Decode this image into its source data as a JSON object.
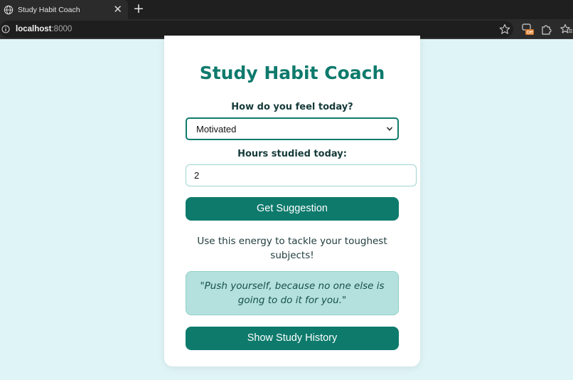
{
  "browser": {
    "tab_title": "Study Habit Coach",
    "tab_close": "✕",
    "new_tab": "+",
    "url_host": "localhost",
    "url_port": ":8000",
    "extension_badge": "Off"
  },
  "app": {
    "title": "Study Habit Coach",
    "mood_label": "How do you feel today?",
    "mood_value": "Motivated",
    "hours_label": "Hours studied today:",
    "hours_value": "2",
    "suggest_button": "Get Suggestion",
    "suggestion_text": "Use this energy to tackle your toughest subjects!",
    "quote_text": "\"Push yourself, because no one else is going to do it for you.\"",
    "history_button": "Show Study History"
  },
  "colors": {
    "page_bg": "#dff4f6",
    "accent": "#0d7a6c",
    "quote_bg": "#b4e1de"
  },
  "icons": {
    "tab_favicon": "globe-icon",
    "site_info": "info-icon",
    "bookmark": "star-icon",
    "extensions": [
      "extension-off-icon",
      "puzzle-icon",
      "favorites-icon"
    ],
    "select_arrow": "chevron-down-icon"
  }
}
